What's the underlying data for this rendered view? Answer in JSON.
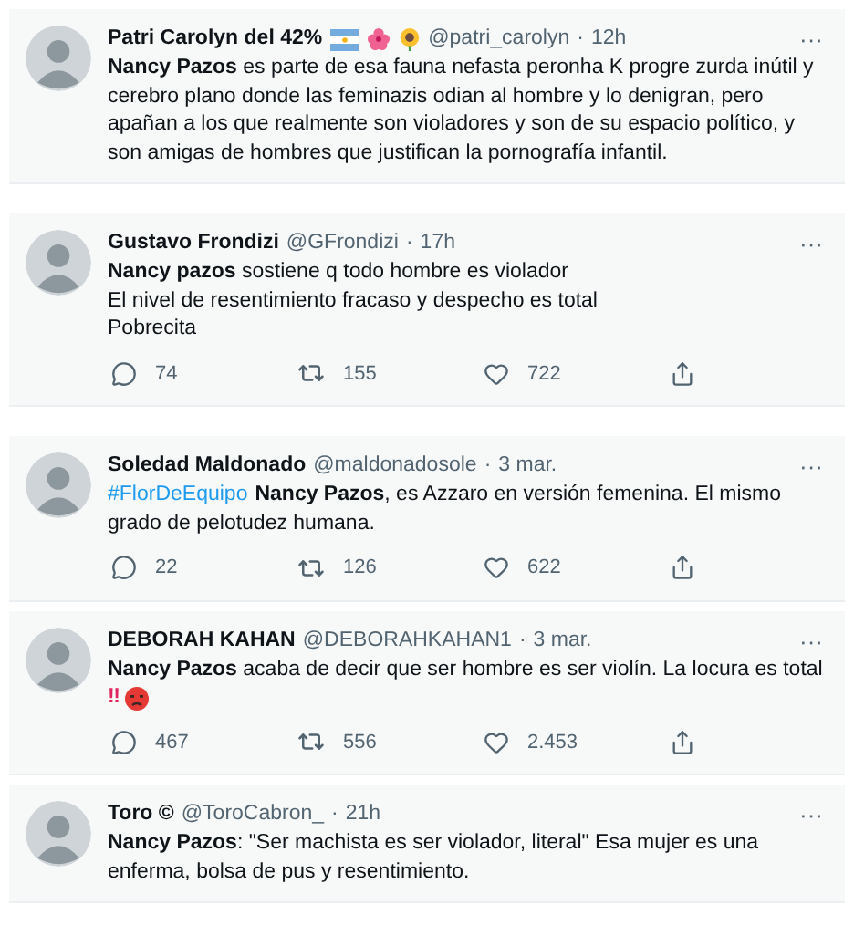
{
  "tweets": [
    {
      "name": "Patri Carolyn del 42%",
      "name_emojis": [
        {
          "kind": "flag"
        },
        {
          "kind": "hibiscus"
        },
        {
          "kind": "sunflower"
        }
      ],
      "handle": "@patri_carolyn",
      "dot": "·",
      "time": "12h",
      "more": "···",
      "lines": [
        "**Nancy Pazos** es parte de esa fauna nefasta peronha K progre zurda inútil y cerebro plano donde las feminazis odian al hombre y lo denigran, pero apañan a los que realmente son violadores y son de su espacio político,  y son amigas de hombres que justifican la pornografía infantil."
      ]
    },
    {
      "name": "Gustavo Frondizi",
      "handle": "@GFrondizi",
      "dot": "·",
      "time": "17h",
      "more": "···",
      "lines": [
        "**Nancy pazos** sostiene q todo hombre es violador",
        "El nivel de resentimiento fracaso y despecho es total",
        "Pobrecita"
      ],
      "stats": {
        "replies": "74",
        "retweets": "155",
        "likes": "722"
      }
    },
    {
      "name": "Soledad Maldonado",
      "handle": "@maldonadosole",
      "dot": "·",
      "time": "3 mar.",
      "more": "···",
      "hashtag": "#FlorDeEquipo",
      "lines": [
        "**Nancy Pazos**, es Azzaro en versión femenina. El mismo grado de pelotudez humana."
      ],
      "stats": {
        "replies": "22",
        "retweets": "126",
        "likes": "622"
      }
    },
    {
      "name": "DEBORAH KAHAN",
      "handle": "@DEBORAHKAHAN1",
      "dot": "·",
      "time": "3 mar.",
      "more": "···",
      "lines": [
        "**Nancy Pazos** acaba de decir que ser hombre es ser violín. La locura es total"
      ],
      "tail": {
        "marks": "‼",
        "emoji": {
          "kind": "angry"
        }
      },
      "stats": {
        "replies": "467",
        "retweets": "556",
        "likes": "2.453"
      }
    },
    {
      "name": "Toro ©",
      "handle": "@ToroCabron_",
      "dot": "·",
      "time": "21h",
      "more": "···",
      "lines": [
        "**Nancy Pazos**: \"Ser machista es ser violador, literal\" Esa mujer es una enferma, bolsa de pus y resentimiento."
      ]
    }
  ]
}
